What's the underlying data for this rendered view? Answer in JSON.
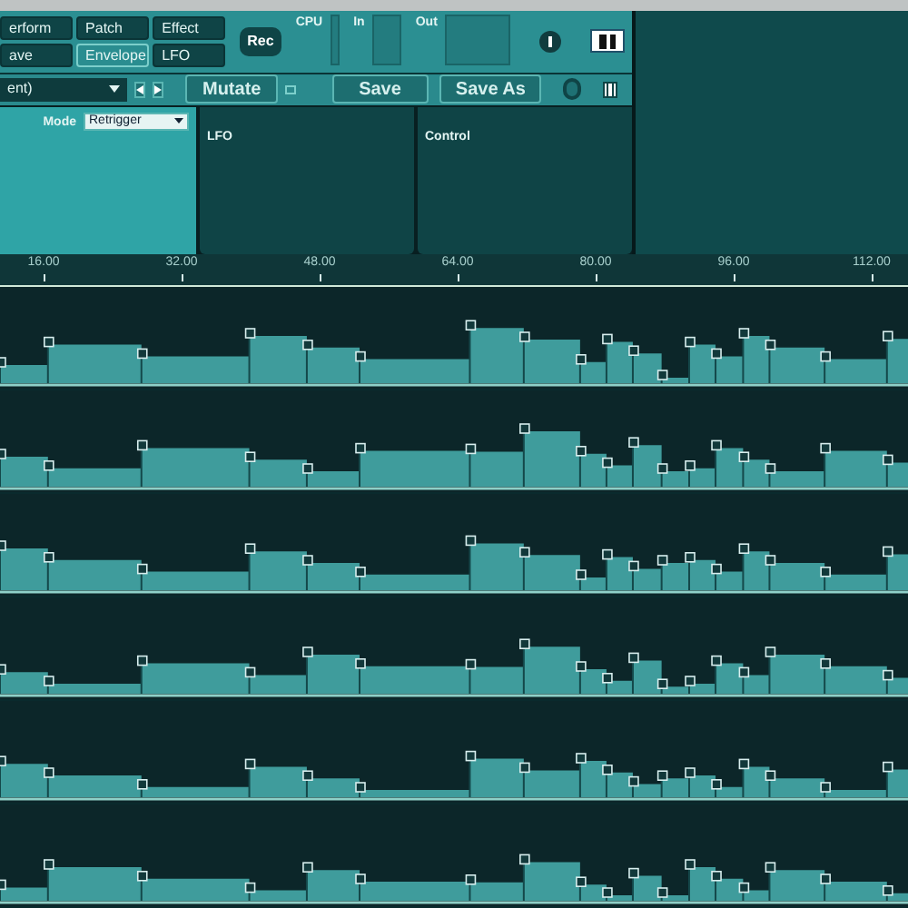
{
  "tabs": [
    {
      "label": "erform",
      "selected": false
    },
    {
      "label": "Patch",
      "selected": false
    },
    {
      "label": "Effect",
      "selected": false
    },
    {
      "label": "ave",
      "selected": false
    },
    {
      "label": "Envelope",
      "selected": true
    },
    {
      "label": "LFO",
      "selected": false
    }
  ],
  "rec_button": "Rec",
  "meters": [
    {
      "label": "CPU"
    },
    {
      "label": "In"
    },
    {
      "label": "Out"
    }
  ],
  "preset": {
    "value": "ent)"
  },
  "mutate_button": "Mutate",
  "save_buttons": [
    "Save",
    "Save As"
  ],
  "mode": {
    "label": "Mode",
    "value": "Retrigger"
  },
  "panels": [
    {
      "title": "LFO"
    },
    {
      "title": "Control"
    }
  ],
  "ruler": {
    "labels": [
      "16.00",
      "32.00",
      "48.00",
      "64.00",
      "80.00",
      "96.00",
      "112.00"
    ]
  }
}
